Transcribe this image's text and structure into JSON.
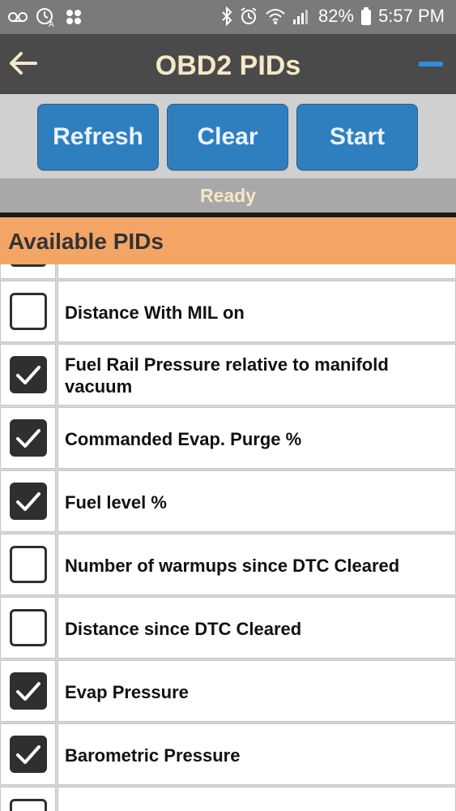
{
  "status_bar": {
    "battery": "82%",
    "time": "5:57 PM",
    "icons": [
      "voicemail-icon",
      "alarm-auto-icon",
      "apps-icon",
      "bluetooth-icon",
      "alarm-icon",
      "wifi-icon",
      "signal-icon",
      "battery-icon"
    ]
  },
  "app_bar": {
    "title": "OBD2 PIDs",
    "back_icon": "arrow-left-icon"
  },
  "toolbar": {
    "refresh_label": "Refresh",
    "clear_label": "Clear",
    "start_label": "Start"
  },
  "status": {
    "text": "Ready"
  },
  "section": {
    "title": "Available PIDs"
  },
  "pids": [
    {
      "label": "",
      "checked": false
    },
    {
      "label": "Distance With MIL on",
      "checked": false
    },
    {
      "label": "Fuel Rail Pressure relative to manifold vacuum",
      "checked": true
    },
    {
      "label": "Commanded Evap. Purge %",
      "checked": true
    },
    {
      "label": "Fuel level %",
      "checked": true
    },
    {
      "label": "Number of warmups since DTC Cleared",
      "checked": false
    },
    {
      "label": "Distance since DTC Cleared",
      "checked": false
    },
    {
      "label": "Evap Pressure",
      "checked": true
    },
    {
      "label": "Barometric Pressure",
      "checked": true
    },
    {
      "label": "",
      "checked": false
    }
  ],
  "colors": {
    "accent_blue": "#2f7fbf",
    "section_orange": "#f3a566",
    "title_cream": "#f6e7c7"
  }
}
